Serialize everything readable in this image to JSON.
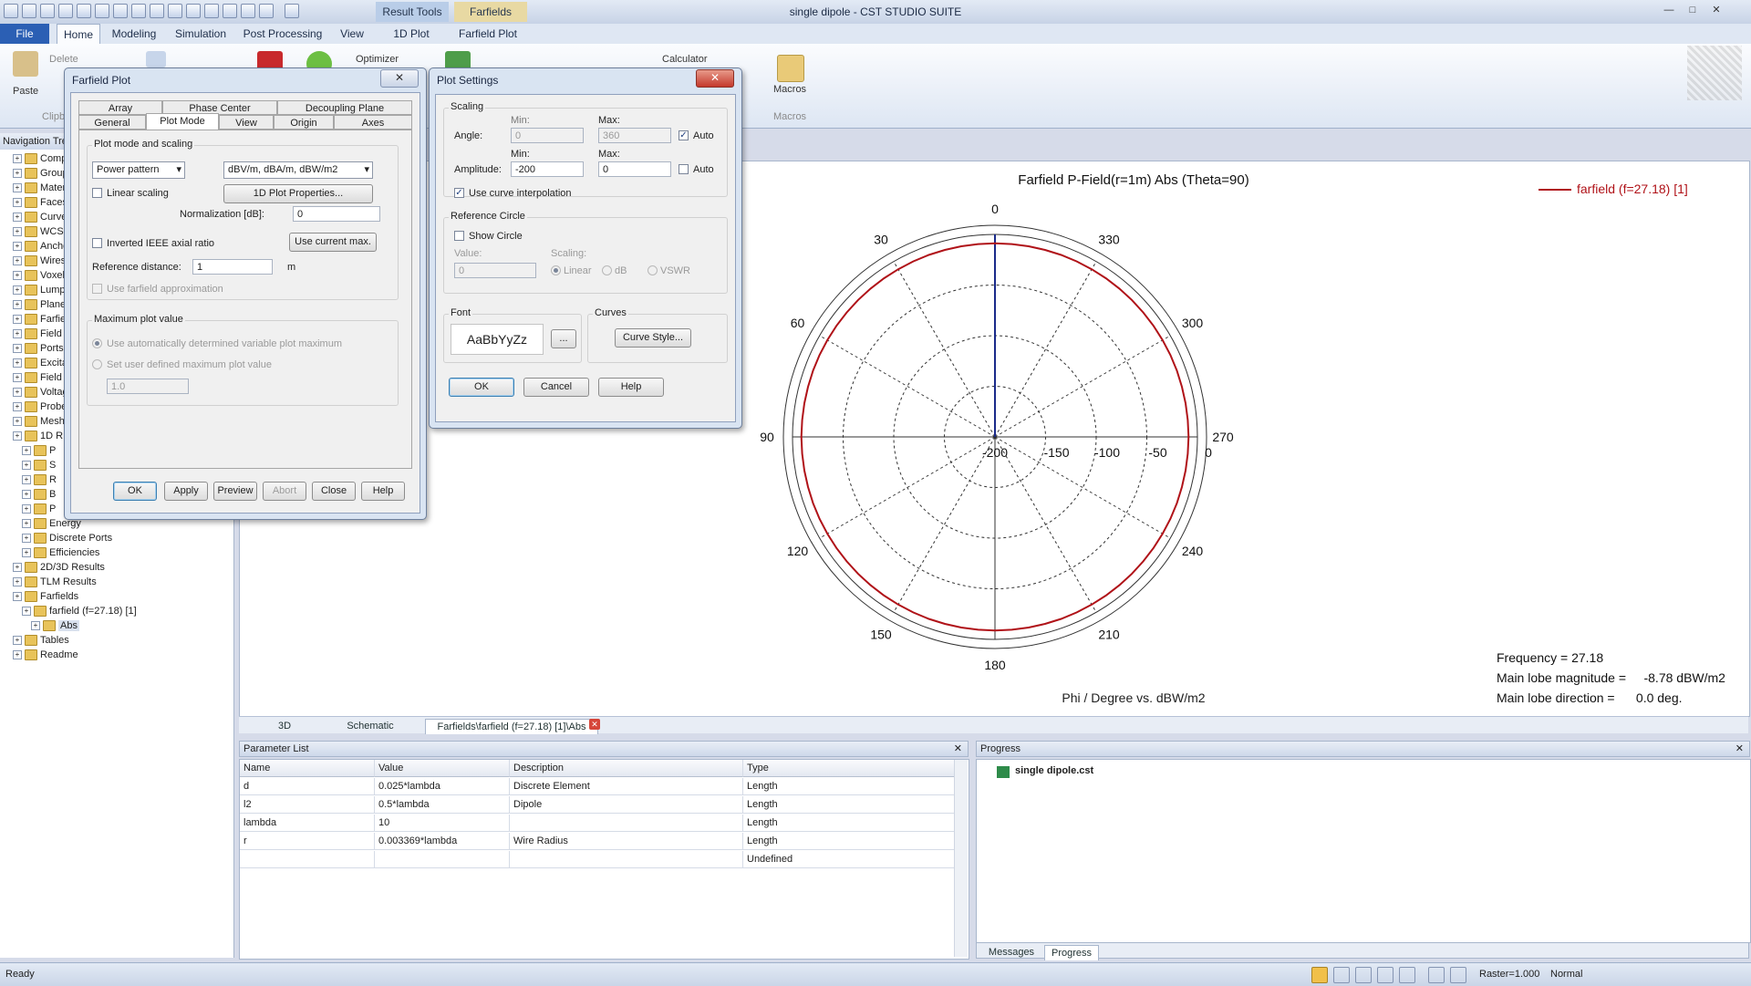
{
  "window": {
    "title": "single dipole - CST STUDIO SUITE",
    "context_tabs": [
      "Result Tools",
      "Farfields"
    ]
  },
  "ribbon": {
    "tabs": [
      "File",
      "Home",
      "Modeling",
      "Simulation",
      "Post Processing",
      "View",
      "1D Plot",
      "Farfield Plot"
    ],
    "items": {
      "paste": "Paste",
      "delete": "Delete",
      "clipboard": "Clipb",
      "optimizer": "Optimizer",
      "calculator": "Calculator",
      "macros": "Macros",
      "macros_group": "Macros"
    }
  },
  "nav": {
    "header": "Navigation Tre",
    "items": [
      "Comp",
      "Group",
      "Mater",
      "Faces",
      "Curve",
      "WCS",
      "Anche",
      "Wires",
      "Voxel",
      "Lump",
      "Plane",
      "Farfie",
      "Field",
      "Ports",
      "Excita",
      "Field",
      "Voltag",
      "Probe",
      "Mesh",
      "1D R",
      "P",
      "S",
      "R",
      "B",
      "P",
      "Energy",
      "Discrete Ports",
      "Efficiencies",
      "2D/3D Results",
      "TLM Results",
      "Farfields",
      "farfield (f=27.18) [1]",
      "Abs",
      "Tables",
      "Readme"
    ]
  },
  "plot": {
    "title": "Farfield P-Field(r=1m) Abs (Theta=90)",
    "xlabel": "Phi / Degree vs. dBW/m2",
    "legend": "farfield (f=27.18) [1]",
    "info": {
      "frequency": "Frequency = 27.18",
      "magnitude": "Main lobe magnitude =     -8.78 dBW/m2",
      "direction": "Main lobe direction =      0.0 deg."
    },
    "colors": {
      "curve": "#b01218",
      "axis": "#1a2a8a"
    }
  },
  "chart_data": {
    "type": "polar",
    "angle_labels": [
      "0",
      "30",
      "60",
      "90",
      "120",
      "150",
      "180",
      "210",
      "240",
      "270",
      "300",
      "330"
    ],
    "radial_labels": [
      "-200",
      "-150",
      "-100",
      "-50",
      "0"
    ],
    "rlim": [
      -200,
      0
    ],
    "series": [
      {
        "name": "farfield (f=27.18) [1]",
        "phi": [
          0,
          30,
          60,
          90,
          120,
          150,
          180,
          210,
          240,
          270,
          300,
          330
        ],
        "values": [
          -8.78,
          -8.78,
          -8.78,
          -8.78,
          -8.78,
          -8.78,
          -8.78,
          -8.78,
          -8.78,
          -8.78,
          -8.78,
          -8.78
        ]
      }
    ],
    "grid": true
  },
  "doc_tabs": [
    "3D",
    "Schematic",
    "Farfields\\farfield (f=27.18) [1]\\Abs"
  ],
  "param_list": {
    "title": "Parameter List",
    "columns": [
      "Name",
      "Value",
      "Description",
      "Type"
    ],
    "rows": [
      [
        "d",
        "0.025*lambda",
        "Discrete Element",
        "Length"
      ],
      [
        "l2",
        "0.5*lambda",
        "Dipole",
        "Length"
      ],
      [
        "lambda",
        "10",
        "",
        "Length"
      ],
      [
        "r",
        "0.003369*lambda",
        "Wire Radius",
        "Length"
      ],
      [
        "",
        "",
        "",
        "Undefined"
      ]
    ]
  },
  "progress": {
    "title": "Progress",
    "item": "single dipole.cst",
    "tabs": [
      "Messages",
      "Progress"
    ]
  },
  "status": {
    "left": "Ready",
    "raster": "Raster=1.000",
    "mode": "Normal"
  },
  "farfield_dialog": {
    "title": "Farfield Plot",
    "tabs_row1": [
      "Array",
      "Phase Center",
      "Decoupling Plane"
    ],
    "tabs_row2": [
      "General",
      "Plot Mode",
      "View",
      "Origin",
      "Axes"
    ],
    "plot_mode_group": "Plot mode and scaling",
    "mode_select": "Power pattern",
    "unit_select": "dBV/m, dBA/m, dBW/m2",
    "linear_scaling": "Linear scaling",
    "props_button": "1D Plot Properties...",
    "normalization_label": "Normalization [dB]:",
    "normalization_value": "0",
    "inverted_ieee": "Inverted IEEE axial ratio",
    "use_current_max": "Use current max.",
    "reference_distance_label": "Reference distance:",
    "reference_distance_value": "1",
    "reference_distance_unit": "m",
    "farfield_approx": "Use farfield approximation",
    "max_group": "Maximum plot value",
    "auto_max": "Use automatically determined variable plot maximum",
    "user_max": "Set user defined maximum plot value",
    "user_max_value": "1.0",
    "buttons": [
      "OK",
      "Apply",
      "Preview",
      "Abort",
      "Close",
      "Help"
    ]
  },
  "settings_dialog": {
    "title": "Plot Settings",
    "scaling_group": "Scaling",
    "angle_label": "Angle:",
    "amplitude_label": "Amplitude:",
    "min_label": "Min:",
    "max_label": "Max:",
    "angle_min": "0",
    "angle_max": "360",
    "amp_min": "-200",
    "amp_max": "0",
    "auto": "Auto",
    "interp": "Use curve interpolation",
    "ref_group": "Reference Circle",
    "show_circle": "Show Circle",
    "value_label": "Value:",
    "value": "0",
    "scaling_label": "Scaling:",
    "scaling_options": [
      "Linear",
      "dB",
      "VSWR"
    ],
    "font_group": "Font",
    "font_sample": "AaBbYyZz",
    "font_button": "...",
    "curves_group": "Curves",
    "curve_style": "Curve Style...",
    "buttons": [
      "OK",
      "Cancel",
      "Help"
    ]
  }
}
